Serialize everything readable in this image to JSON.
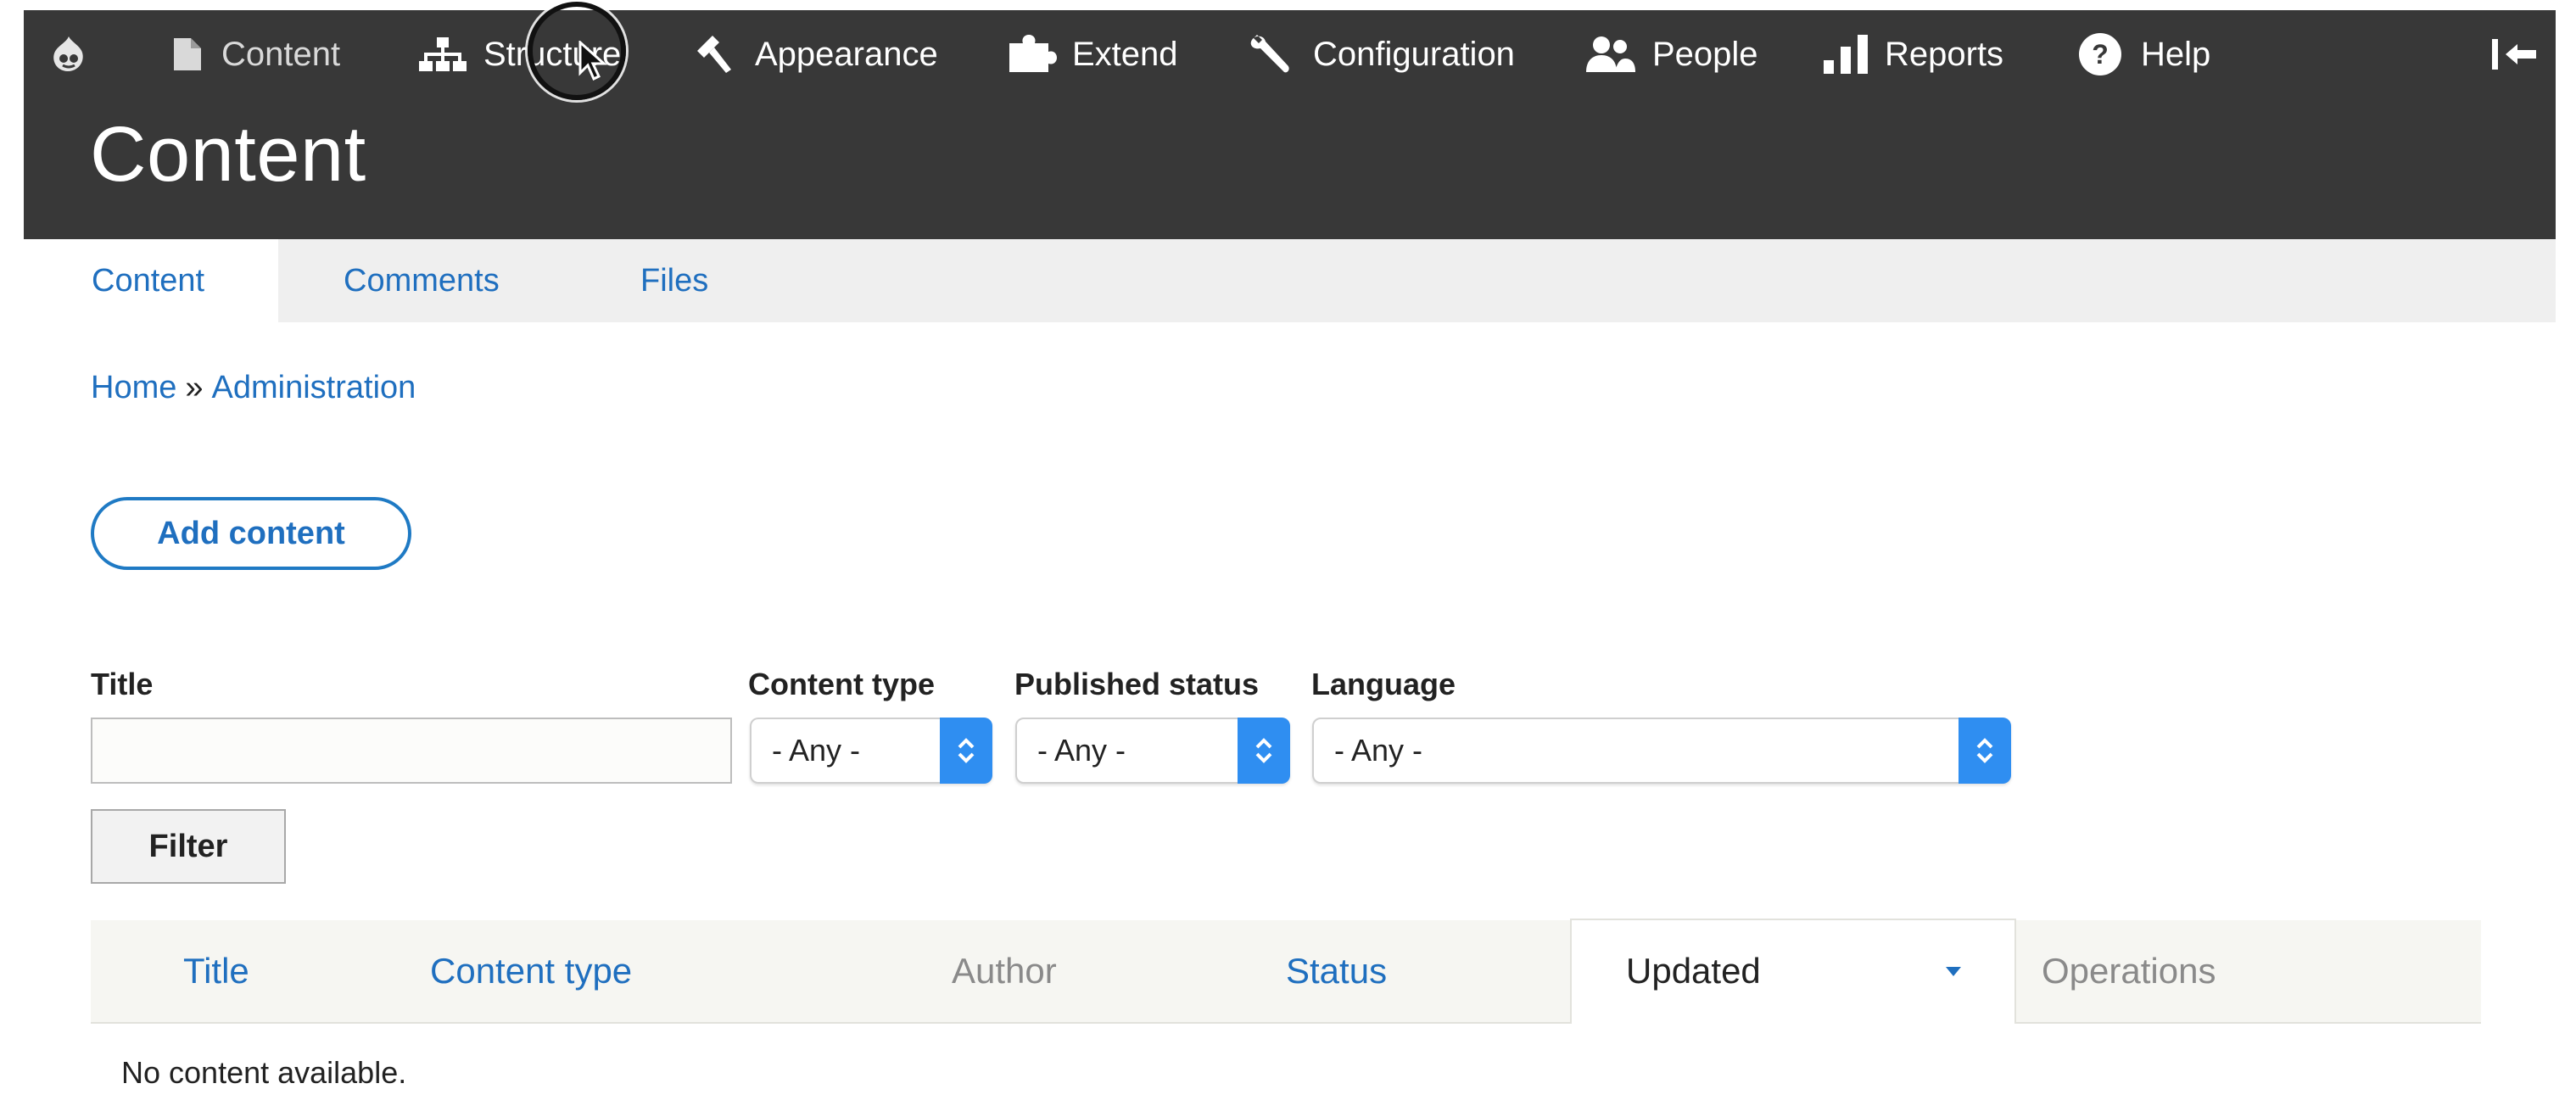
{
  "toolbar": {
    "items": [
      {
        "label": "Content",
        "icon": "file-icon"
      },
      {
        "label": "Structure",
        "icon": "sitemap-icon"
      },
      {
        "label": "Appearance",
        "icon": "paintbrush-icon"
      },
      {
        "label": "Extend",
        "icon": "puzzle-icon"
      },
      {
        "label": "Configuration",
        "icon": "wrench-icon"
      },
      {
        "label": "People",
        "icon": "people-icon"
      },
      {
        "label": "Reports",
        "icon": "bar-chart-icon"
      },
      {
        "label": "Help",
        "icon": "help-icon"
      }
    ],
    "home_icon": "drupal-logo-icon",
    "collapse_icon": "collapse-toolbar-icon"
  },
  "page_title": "Content",
  "tabs": [
    {
      "label": "Content",
      "active": true
    },
    {
      "label": "Comments",
      "active": false
    },
    {
      "label": "Files",
      "active": false
    }
  ],
  "breadcrumb": {
    "items": [
      "Home",
      "Administration"
    ],
    "separator": "»"
  },
  "add_content_label": "Add content",
  "filters": {
    "title_label": "Title",
    "title_value": "",
    "content_type_label": "Content type",
    "content_type_value": "- Any -",
    "published_status_label": "Published status",
    "published_status_value": "- Any -",
    "language_label": "Language",
    "language_value": "- Any -",
    "filter_button_label": "Filter"
  },
  "table": {
    "columns": [
      {
        "label": "Title",
        "sortable": true
      },
      {
        "label": "Content type",
        "sortable": true
      },
      {
        "label": "Author",
        "sortable": false
      },
      {
        "label": "Status",
        "sortable": true
      },
      {
        "label": "Updated",
        "sortable": true,
        "active_sort": true
      },
      {
        "label": "Operations",
        "sortable": false
      }
    ],
    "empty_message": "No content available."
  },
  "colors": {
    "toolbar_bg": "#383838",
    "link": "#1f6fbf",
    "select_accent": "#2f8ef1",
    "tabs_bg": "#efefef"
  }
}
